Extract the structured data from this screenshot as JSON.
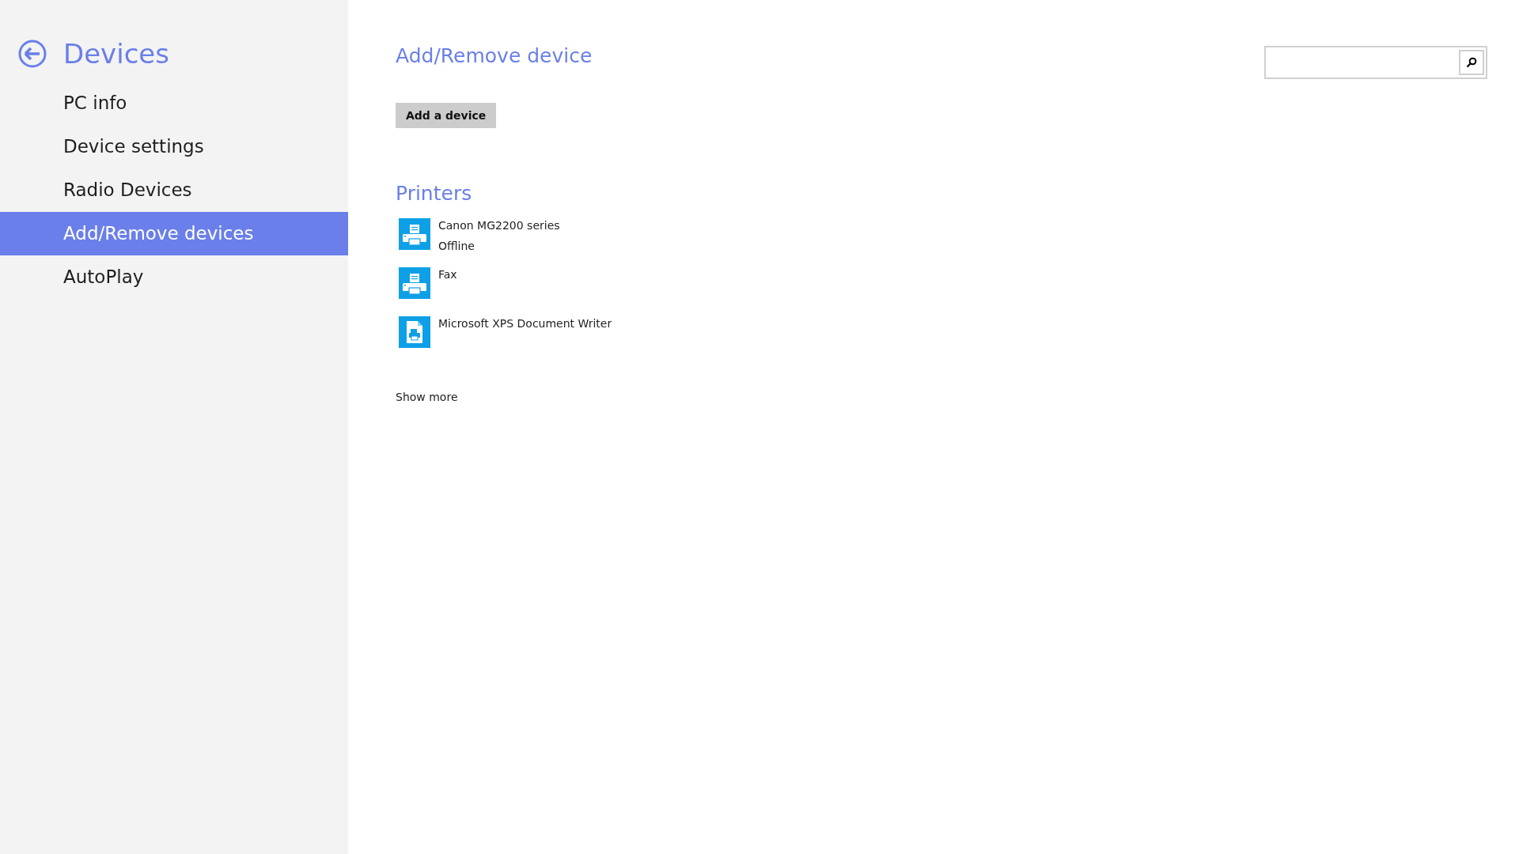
{
  "sidebar": {
    "title": "Devices",
    "items": [
      {
        "label": "PC info",
        "selected": false
      },
      {
        "label": "Device settings",
        "selected": false
      },
      {
        "label": "Radio Devices",
        "selected": false
      },
      {
        "label": "Add/Remove devices",
        "selected": true
      },
      {
        "label": "AutoPlay",
        "selected": false
      }
    ]
  },
  "main": {
    "title": "Add/Remove device",
    "add_button": "Add a device",
    "section_title": "Printers",
    "devices": [
      {
        "kind": "printer",
        "name": "Canon MG2200 series",
        "status": "Offline"
      },
      {
        "kind": "printer",
        "name": "Fax"
      },
      {
        "kind": "document",
        "name": "Microsoft XPS Document Writer"
      }
    ],
    "show_more": "Show more"
  }
}
